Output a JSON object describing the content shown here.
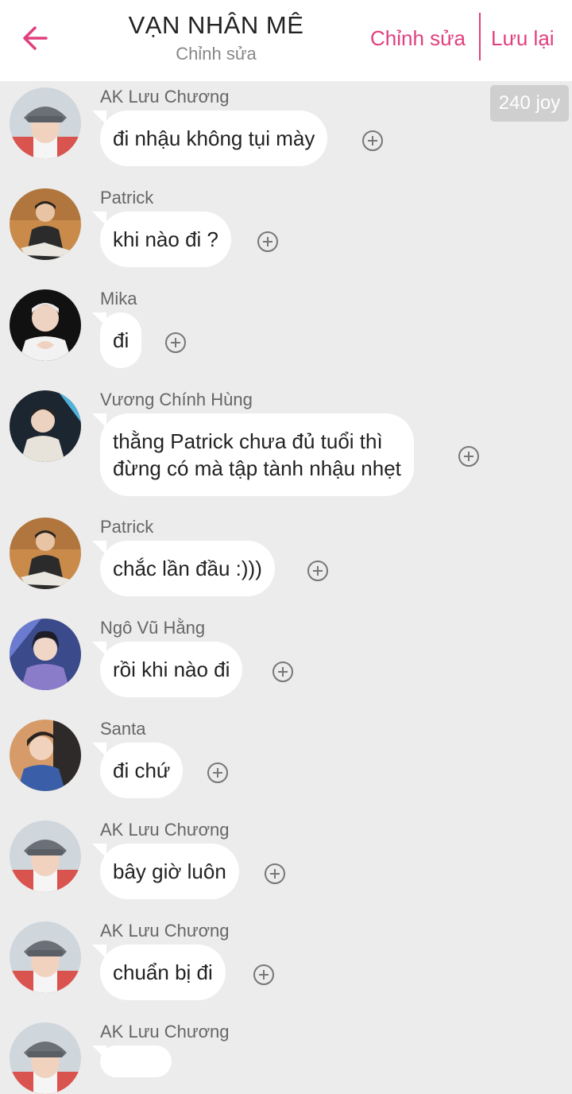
{
  "header": {
    "title": "VẠN NHÂN MÊ",
    "subtitle": "Chỉnh sửa",
    "edit_label": "Chỉnh sửa",
    "save_label": "Lưu lại",
    "accent_color": "#e0407f"
  },
  "joy_badge": "240 joy",
  "messages": [
    {
      "sender": "AK Lưu Chương",
      "text": "đi nhậu không tụi mày",
      "avatar": "ak-bucket-hat"
    },
    {
      "sender": "Patrick",
      "text": "khi nào đi ?",
      "avatar": "patrick"
    },
    {
      "sender": "Mika",
      "text": "đi",
      "avatar": "mika"
    },
    {
      "sender": "Vương Chính Hùng",
      "text": "thằng Patrick chưa đủ tuổi thì",
      "text2": "đừng có mà tập tành nhậu nhẹt",
      "avatar": "vuong-chinh-hung"
    },
    {
      "sender": "Patrick",
      "text": "chắc lần đầu :)))",
      "avatar": "patrick"
    },
    {
      "sender": "Ngô Vũ Hằng",
      "text": "rồi khi nào đi",
      "avatar": "ngo-vu-hang"
    },
    {
      "sender": "Santa",
      "text": "đi chứ",
      "avatar": "santa"
    },
    {
      "sender": "AK Lưu Chương",
      "text": "bây giờ luôn",
      "avatar": "ak-bucket-hat"
    },
    {
      "sender": "AK Lưu Chương",
      "text": "chuẩn bị đi",
      "avatar": "ak-bucket-hat"
    },
    {
      "sender": "AK Lưu Chương",
      "text": "",
      "avatar": "ak-bucket-hat"
    }
  ]
}
